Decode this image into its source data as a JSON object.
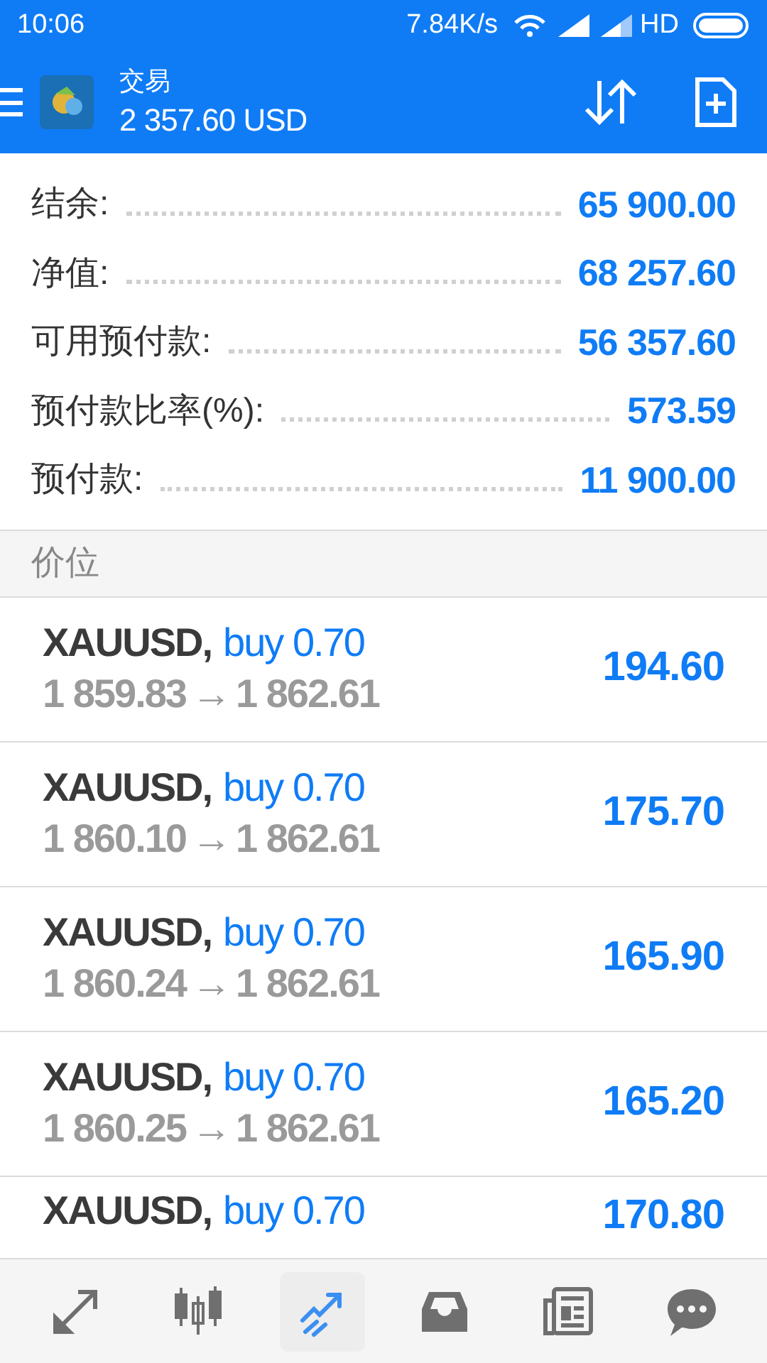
{
  "status_bar": {
    "time": "10:06",
    "speed": "7.84K/s",
    "network": "HD"
  },
  "header": {
    "title": "交易",
    "balance": "2 357.60 USD"
  },
  "summary": [
    {
      "label": "结余:",
      "value": "65 900.00"
    },
    {
      "label": "净值:",
      "value": "68 257.60"
    },
    {
      "label": "可用预付款:",
      "value": "56 357.60"
    },
    {
      "label": "预付款比率(%):",
      "value": "573.59"
    },
    {
      "label": "预付款:",
      "value": "11 900.00"
    }
  ],
  "section": {
    "title": "价位"
  },
  "positions": [
    {
      "symbol": "XAUUSD,",
      "side": "buy 0.70",
      "open": "1 859.83",
      "arrow": "→",
      "current": "1 862.61",
      "profit": "194.60"
    },
    {
      "symbol": "XAUUSD,",
      "side": "buy 0.70",
      "open": "1 860.10",
      "arrow": "→",
      "current": "1 862.61",
      "profit": "175.70"
    },
    {
      "symbol": "XAUUSD,",
      "side": "buy 0.70",
      "open": "1 860.24",
      "arrow": "→",
      "current": "1 862.61",
      "profit": "165.90"
    },
    {
      "symbol": "XAUUSD,",
      "side": "buy 0.70",
      "open": "1 860.25",
      "arrow": "→",
      "current": "1 862.61",
      "profit": "165.20"
    },
    {
      "symbol": "XAUUSD,",
      "side": "buy 0.70",
      "profit": "170.80"
    }
  ],
  "nav": [
    {
      "selected": false
    },
    {
      "selected": false
    },
    {
      "selected": true
    },
    {
      "selected": false
    },
    {
      "selected": false
    },
    {
      "selected": false
    }
  ]
}
